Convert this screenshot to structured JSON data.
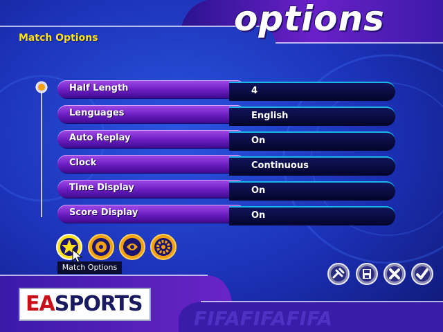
{
  "header": {
    "title": "options"
  },
  "section": {
    "title": "Match Options"
  },
  "settings": [
    {
      "label": "Half Length",
      "value": "4"
    },
    {
      "label": "Lenguages",
      "value": "English"
    },
    {
      "label": "Auto Replay",
      "value": "On"
    },
    {
      "label": "Clock",
      "value": "Continuous"
    },
    {
      "label": "Time Display",
      "value": "On"
    },
    {
      "label": "Score Display",
      "value": "On"
    }
  ],
  "tabs": {
    "active_index": 0,
    "items": [
      "match-options-tab",
      "tab-2",
      "tab-3",
      "tab-4"
    ]
  },
  "tooltip": {
    "text": "Match Options"
  },
  "logo": {
    "ea": "EA",
    "sports": "SPORTS"
  },
  "buttons": [
    "controller-icon",
    "save-icon",
    "close-icon",
    "check-icon"
  ],
  "colors": {
    "accent_yellow": "#ffe21c",
    "row_purple": "#7a2ad0",
    "value_dark": "#07083a",
    "cyan": "#19b7e8"
  }
}
